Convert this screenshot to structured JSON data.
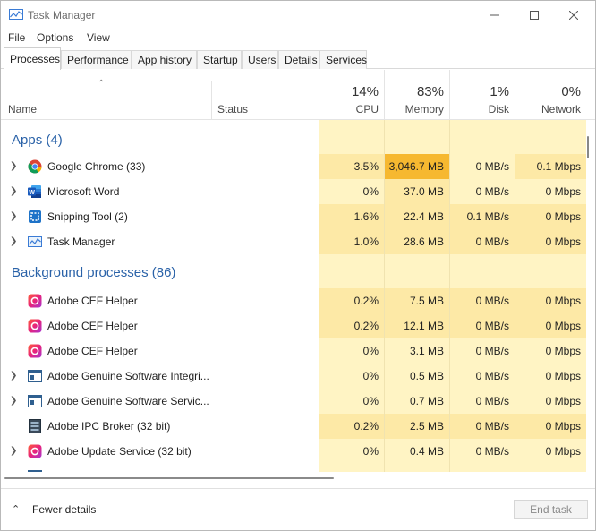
{
  "window": {
    "title": "Task Manager"
  },
  "menu": [
    "File",
    "Options",
    "View"
  ],
  "tabs": [
    "Processes",
    "Performance",
    "App history",
    "Startup",
    "Users",
    "Details",
    "Services"
  ],
  "header": {
    "name": "Name",
    "status": "Status",
    "cpu": {
      "pct": "14%",
      "label": "CPU"
    },
    "memory": {
      "pct": "83%",
      "label": "Memory"
    },
    "disk": {
      "pct": "1%",
      "label": "Disk"
    },
    "network": {
      "pct": "0%",
      "label": "Network"
    }
  },
  "groups": {
    "apps": "Apps (4)",
    "background": "Background processes (86)"
  },
  "apps": [
    {
      "name": "Google Chrome (33)",
      "cpu": "3.5%",
      "memory": "3,046.7 MB",
      "disk": "0 MB/s",
      "network": "0.1 Mbps",
      "icon": "chrome-icon"
    },
    {
      "name": "Microsoft Word",
      "cpu": "0%",
      "memory": "37.0 MB",
      "disk": "0 MB/s",
      "network": "0 Mbps",
      "icon": "word-icon"
    },
    {
      "name": "Snipping Tool (2)",
      "cpu": "1.6%",
      "memory": "22.4 MB",
      "disk": "0.1 MB/s",
      "network": "0 Mbps",
      "icon": "snipping-tool-icon"
    },
    {
      "name": "Task Manager",
      "cpu": "1.0%",
      "memory": "28.6 MB",
      "disk": "0 MB/s",
      "network": "0 Mbps",
      "icon": "task-manager-icon"
    }
  ],
  "background": [
    {
      "name": "Adobe CEF Helper",
      "cpu": "0.2%",
      "memory": "7.5 MB",
      "disk": "0 MB/s",
      "network": "0 Mbps",
      "icon": "adobe-cc-icon"
    },
    {
      "name": "Adobe CEF Helper",
      "cpu": "0.2%",
      "memory": "12.1 MB",
      "disk": "0 MB/s",
      "network": "0 Mbps",
      "icon": "adobe-cc-icon"
    },
    {
      "name": "Adobe CEF Helper",
      "cpu": "0%",
      "memory": "3.1 MB",
      "disk": "0 MB/s",
      "network": "0 Mbps",
      "icon": "adobe-cc-icon"
    },
    {
      "name": "Adobe Genuine Software Integri...",
      "cpu": "0%",
      "memory": "0.5 MB",
      "disk": "0 MB/s",
      "network": "0 Mbps",
      "icon": "service-window-icon"
    },
    {
      "name": "Adobe Genuine Software Servic...",
      "cpu": "0%",
      "memory": "0.7 MB",
      "disk": "0 MB/s",
      "network": "0 Mbps",
      "icon": "service-window-icon"
    },
    {
      "name": "Adobe IPC Broker (32 bit)",
      "cpu": "0.2%",
      "memory": "2.5 MB",
      "disk": "0 MB/s",
      "network": "0 Mbps",
      "icon": "broker-icon"
    },
    {
      "name": "Adobe Update Service (32 bit)",
      "cpu": "0%",
      "memory": "0.4 MB",
      "disk": "0 MB/s",
      "network": "0 Mbps",
      "icon": "adobe-cc-icon"
    }
  ],
  "footer": {
    "fewer_details": "Fewer details",
    "end_task": "End task"
  },
  "colors": {
    "group_title": "#2a62a8",
    "heat_light": "#fff4c4",
    "heat_medium": "#fde9a6",
    "heat_high": "#f6b830"
  }
}
